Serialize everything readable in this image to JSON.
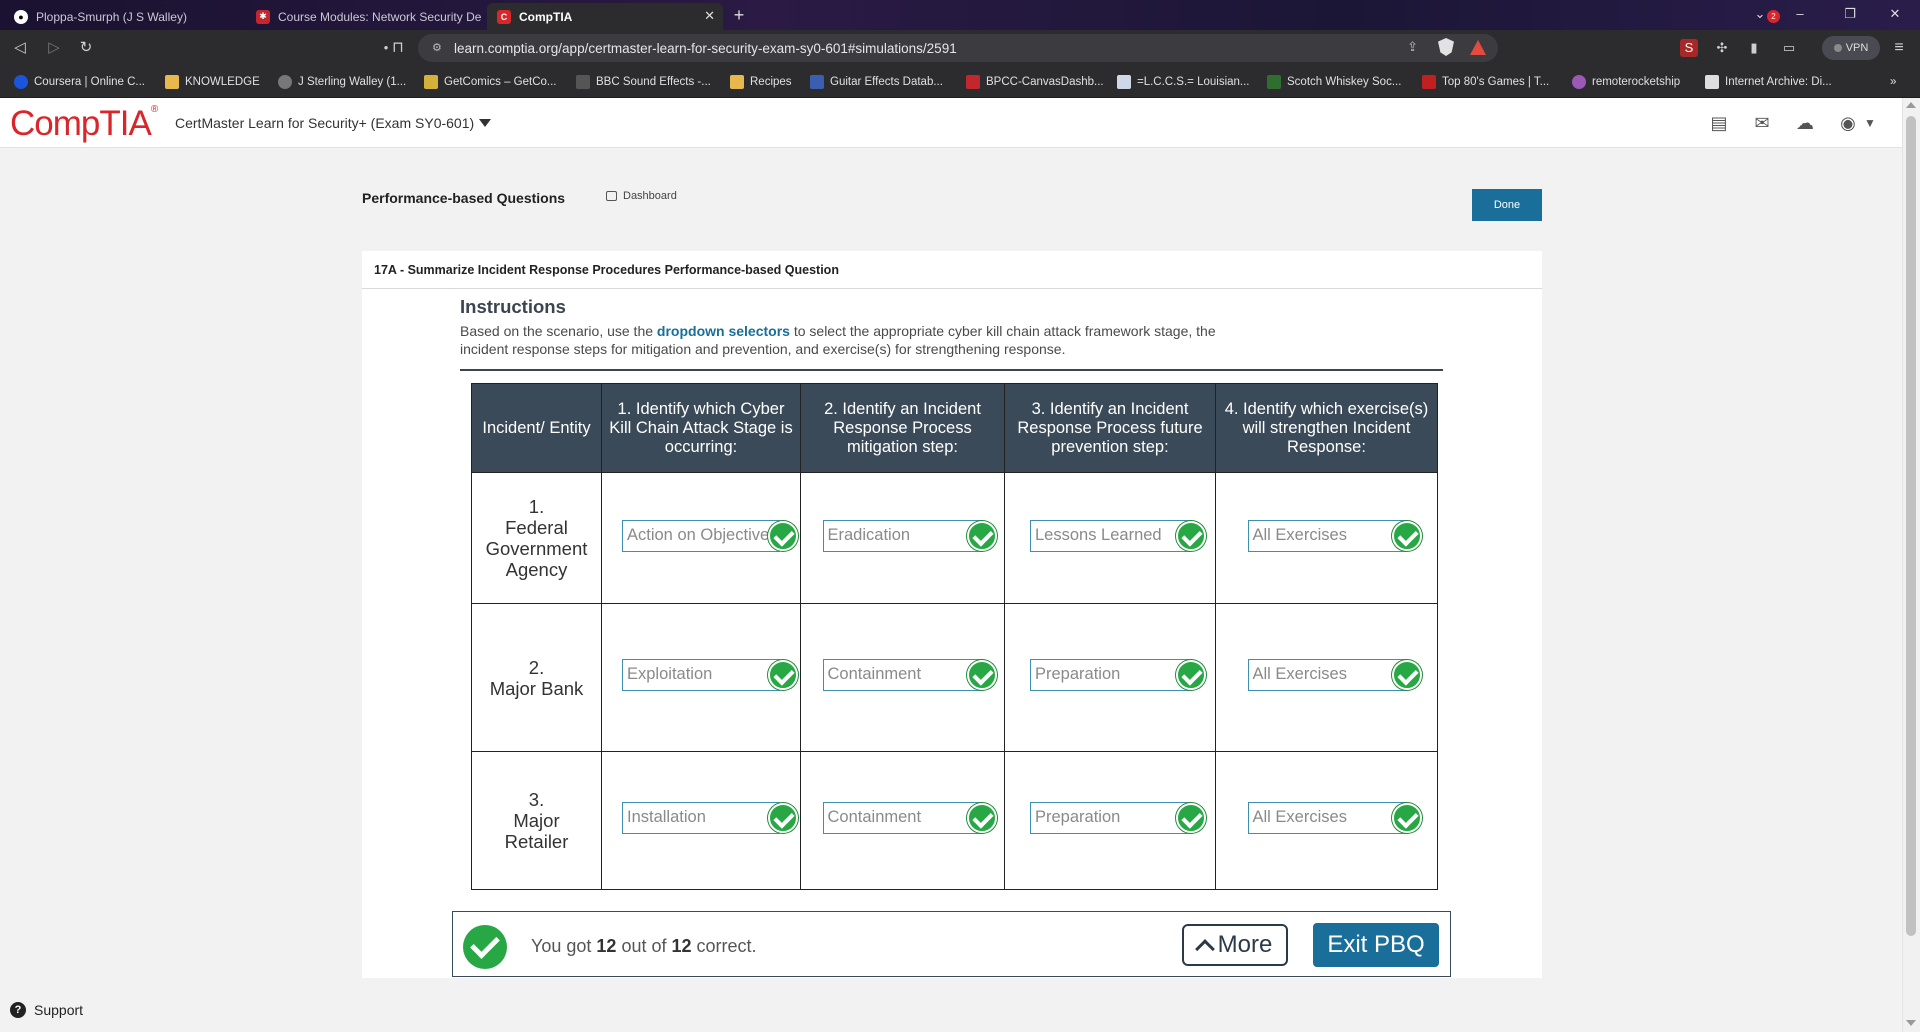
{
  "browser": {
    "tabs": [
      {
        "title": "Ploppa-Smurph (J S Walley)",
        "icon": "github-icon"
      },
      {
        "title": "Course Modules: Network Security De",
        "icon": "canvas-icon"
      },
      {
        "title": "CompTIA",
        "icon": "comptia-icon",
        "active": true
      }
    ],
    "new_tab": "+",
    "url": "learn.comptia.org/app/certmaster-learn-for-security-exam-sy0-601#simulations/2591",
    "vpn_label": "VPN",
    "bookmarks": [
      "Coursera | Online C...",
      "KNOWLEDGE",
      "J Sterling Walley (1...",
      "GetComics – GetCo...",
      "BBC Sound Effects -...",
      "Recipes",
      "Guitar Effects Datab...",
      "BPCC-CanvasDashb...",
      "=L.C.C.S.= Louisian...",
      "Scotch Whiskey Soc...",
      "Top 80's Games | T...",
      "remoterocketship",
      "Internet Archive: Di..."
    ],
    "bookmarks_more": "»"
  },
  "app": {
    "logo": "CompTIA",
    "course_name": "CertMaster Learn for Security+ (Exam SY0-601)",
    "notification_count": "2"
  },
  "page": {
    "title": "Performance-based Questions",
    "dashboard_label": "Dashboard",
    "done_label": "Done",
    "card_title": "17A - Summarize Incident Response Procedures Performance-based Question",
    "instructions_title": "Instructions",
    "instructions_before": "Based on the scenario, use  the ",
    "instructions_highlight": "dropdown selectors",
    "instructions_after": " to select the appropriate cyber kill chain attack framework stage, the incident response steps for mitigation and prevention, and exercise(s) for strengthening response."
  },
  "table": {
    "headers": [
      "Incident/ Entity",
      "1. Identify which Cyber Kill Chain Attack Stage is occurring:",
      "2. Identify an Incident Response Process mitigation step:",
      "3. Identify an Incident Response Process future prevention step:",
      "4. Identify which exercise(s) will strengthen Incident Response:"
    ],
    "rows": [
      {
        "num": "1.",
        "entity": "Federal Government Agency",
        "answers": [
          "Action on Objectives",
          "Eradication",
          "Lessons Learned",
          "All Exercises"
        ]
      },
      {
        "num": "2.",
        "entity": "Major Bank",
        "answers": [
          "Exploitation",
          "Containment",
          "Preparation",
          "All Exercises"
        ]
      },
      {
        "num": "3.",
        "entity": "Major Retailer",
        "answers": [
          "Installation",
          "Containment",
          "Preparation",
          "All Exercises"
        ]
      }
    ]
  },
  "result": {
    "prefix": "You got ",
    "score": "12",
    "middle": " out of ",
    "total": "12",
    "suffix": " correct.",
    "more_label": "More",
    "exit_label": "Exit PBQ"
  },
  "support_label": "Support",
  "colors": {
    "brand_red": "#d9262a",
    "accent_blue": "#1a6e9a",
    "header_slate": "#3b4a58",
    "correct_green": "#28a745"
  }
}
